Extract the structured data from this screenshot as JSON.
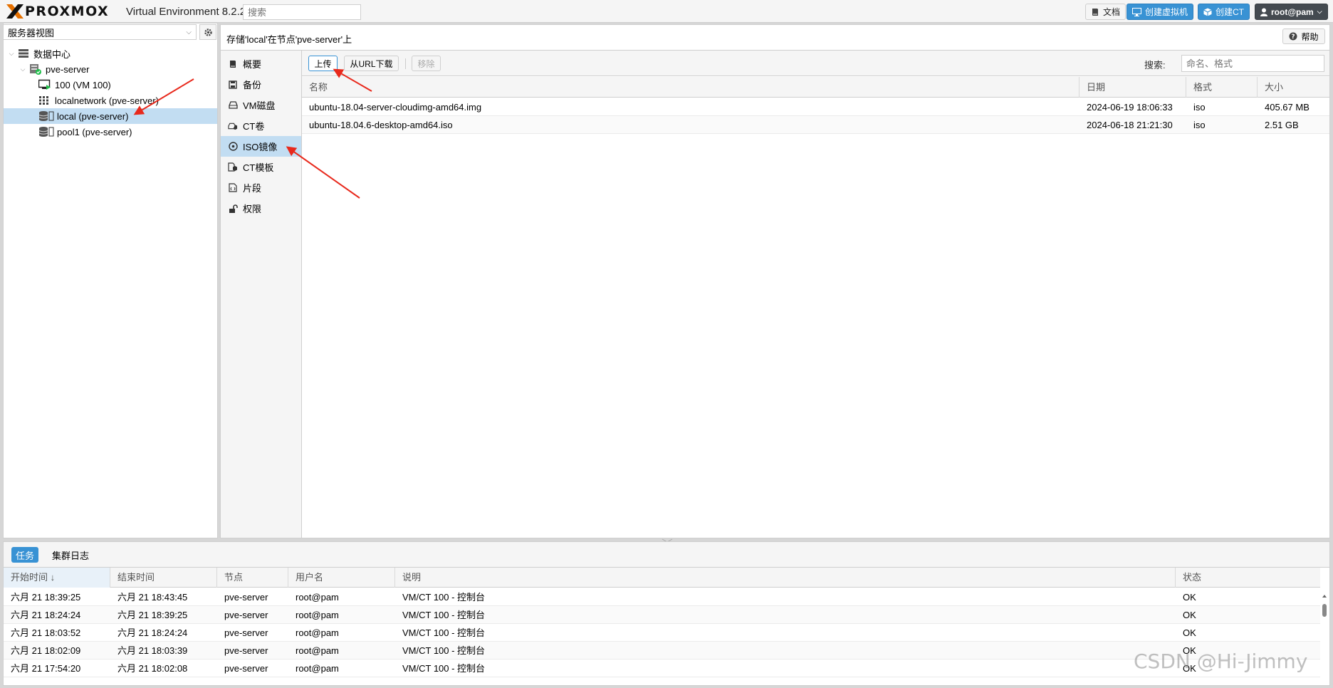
{
  "header": {
    "brand": "PROXMOX",
    "product": "Virtual Environment 8.2.2",
    "search_placeholder": "搜索",
    "buttons": {
      "docs": "文档",
      "create_vm": "创建虚拟机",
      "create_ct": "创建CT",
      "user": "root@pam"
    }
  },
  "sidebar": {
    "view": "服务器视图",
    "tree": {
      "datacenter": "数据中心",
      "node": "pve-server",
      "items": [
        {
          "label": "100 (VM 100)",
          "icon": "vm-running-icon"
        },
        {
          "label": "localnetwork (pve-server)",
          "icon": "network-grid-icon"
        },
        {
          "label": "local (pve-server)",
          "icon": "storage-icon"
        },
        {
          "label": "pool1 (pve-server)",
          "icon": "storage-icon"
        }
      ]
    }
  },
  "content": {
    "title": "存储'local'在节点'pve-server'上",
    "help": "帮助",
    "nav": [
      {
        "label": "概要",
        "icon": "book-icon"
      },
      {
        "label": "备份",
        "icon": "floppy-icon"
      },
      {
        "label": "VM磁盘",
        "icon": "hdd-icon"
      },
      {
        "label": "CT卷",
        "icon": "ct-volume-icon"
      },
      {
        "label": "ISO镜像",
        "icon": "disc-icon"
      },
      {
        "label": "CT模板",
        "icon": "ct-template-icon"
      },
      {
        "label": "片段",
        "icon": "file-code-icon"
      },
      {
        "label": "权限",
        "icon": "unlock-icon"
      }
    ],
    "selected_nav": "ISO镜像",
    "toolbar": {
      "upload": "上传",
      "download_url": "从URL下载",
      "remove": "移除",
      "search_label": "搜索:",
      "search_placeholder": "命名、格式"
    },
    "grid": {
      "columns": [
        "名称",
        "日期",
        "格式",
        "大小"
      ],
      "rows": [
        [
          "ubuntu-18.04-server-cloudimg-amd64.img",
          "2024-06-19 18:06:33",
          "iso",
          "405.67 MB"
        ],
        [
          "ubuntu-18.04.6-desktop-amd64.iso",
          "2024-06-18 21:21:30",
          "iso",
          "2.51 GB"
        ]
      ]
    }
  },
  "log": {
    "tabs": [
      "任务",
      "集群日志"
    ],
    "columns": [
      "开始时间 ↓",
      "结束时间",
      "节点",
      "用户名",
      "说明",
      "状态"
    ],
    "rows": [
      [
        "六月 21 18:39:25",
        "六月 21 18:43:45",
        "pve-server",
        "root@pam",
        "VM/CT 100 - 控制台",
        "OK"
      ],
      [
        "六月 21 18:24:24",
        "六月 21 18:39:25",
        "pve-server",
        "root@pam",
        "VM/CT 100 - 控制台",
        "OK"
      ],
      [
        "六月 21 18:03:52",
        "六月 21 18:24:24",
        "pve-server",
        "root@pam",
        "VM/CT 100 - 控制台",
        "OK"
      ],
      [
        "六月 21 18:02:09",
        "六月 21 18:03:39",
        "pve-server",
        "root@pam",
        "VM/CT 100 - 控制台",
        "OK"
      ],
      [
        "六月 21 17:54:20",
        "六月 21 18:02:08",
        "pve-server",
        "root@pam",
        "VM/CT 100 - 控制台",
        "OK"
      ]
    ]
  },
  "watermark": "CSDN @Hi-Jimmy",
  "colors": {
    "accent": "#3892d4",
    "selection": "#c2ddf2",
    "annotation_arrow": "#e8291c",
    "brand_orange": "#e57000"
  }
}
